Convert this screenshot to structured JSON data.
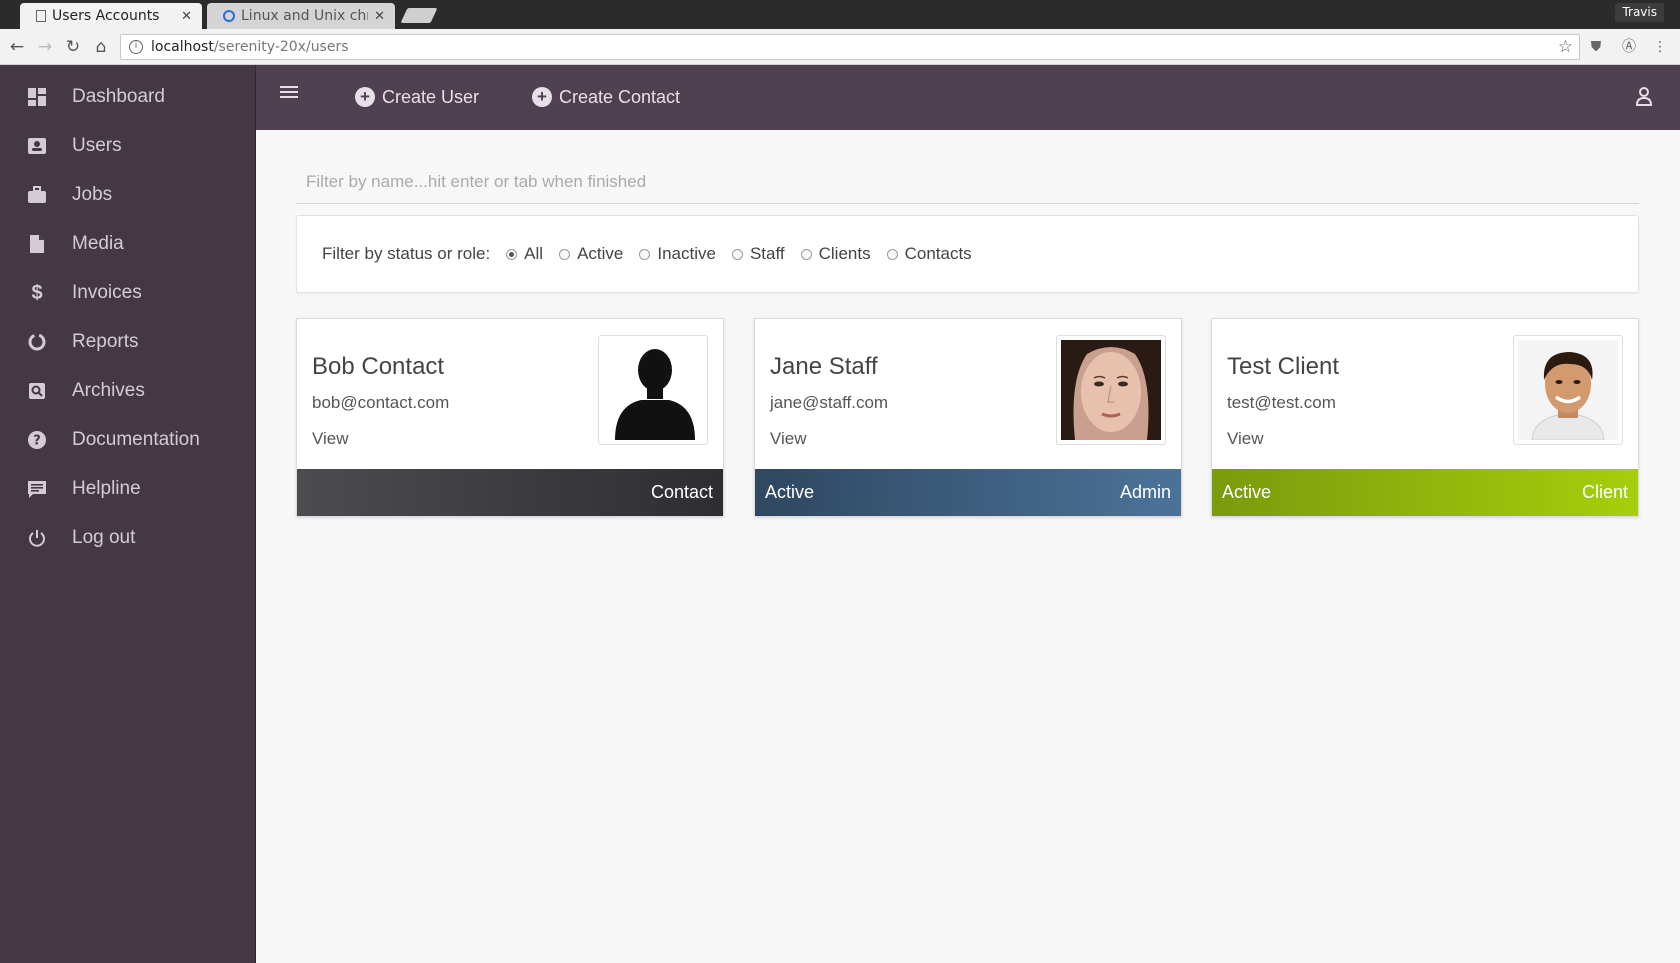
{
  "browser": {
    "tabs": [
      {
        "title": "Users Accounts",
        "active": true
      },
      {
        "title": "Linux and Unix chm",
        "active": false
      }
    ],
    "profile_name": "Travis",
    "url_host": "localhost",
    "url_path": "/serenity-20x/users"
  },
  "sidebar": {
    "items": [
      {
        "label": "Dashboard",
        "icon": "dashboard-icon"
      },
      {
        "label": "Users",
        "icon": "users-icon"
      },
      {
        "label": "Jobs",
        "icon": "briefcase-icon"
      },
      {
        "label": "Media",
        "icon": "file-icon"
      },
      {
        "label": "Invoices",
        "icon": "dollar-icon"
      },
      {
        "label": "Reports",
        "icon": "reports-icon"
      },
      {
        "label": "Archives",
        "icon": "archive-search-icon"
      },
      {
        "label": "Documentation",
        "icon": "help-icon"
      },
      {
        "label": "Helpline",
        "icon": "chat-icon"
      },
      {
        "label": "Log out",
        "icon": "power-icon"
      }
    ]
  },
  "header": {
    "create_user_label": "Create User",
    "create_contact_label": "Create Contact"
  },
  "filter": {
    "placeholder": "Filter by name...hit enter or tab when finished",
    "value": ""
  },
  "status_filter": {
    "label": "Filter by status or role:",
    "options": [
      {
        "label": "All",
        "checked": true
      },
      {
        "label": "Active",
        "checked": false
      },
      {
        "label": "Inactive",
        "checked": false
      },
      {
        "label": "Staff",
        "checked": false
      },
      {
        "label": "Clients",
        "checked": false
      },
      {
        "label": "Contacts",
        "checked": false
      }
    ]
  },
  "users": [
    {
      "name": "Bob Contact",
      "email": "bob@contact.com",
      "view_label": "View",
      "status": "",
      "role": "Contact",
      "footer_color": "#3a3a3e",
      "avatar": "silhouette"
    },
    {
      "name": "Jane Staff",
      "email": "jane@staff.com",
      "view_label": "View",
      "status": "Active",
      "role": "Admin",
      "footer_color": "#3d5d80",
      "avatar": "female-photo"
    },
    {
      "name": "Test Client",
      "email": "test@test.com",
      "view_label": "View",
      "status": "Active",
      "role": "Client",
      "footer_color": "#93b70b",
      "avatar": "male-photo"
    }
  ],
  "colors": {
    "sidebar_bg": "#433843",
    "header_bg": "#4f4150",
    "content_bg": "#f7f7f7"
  }
}
